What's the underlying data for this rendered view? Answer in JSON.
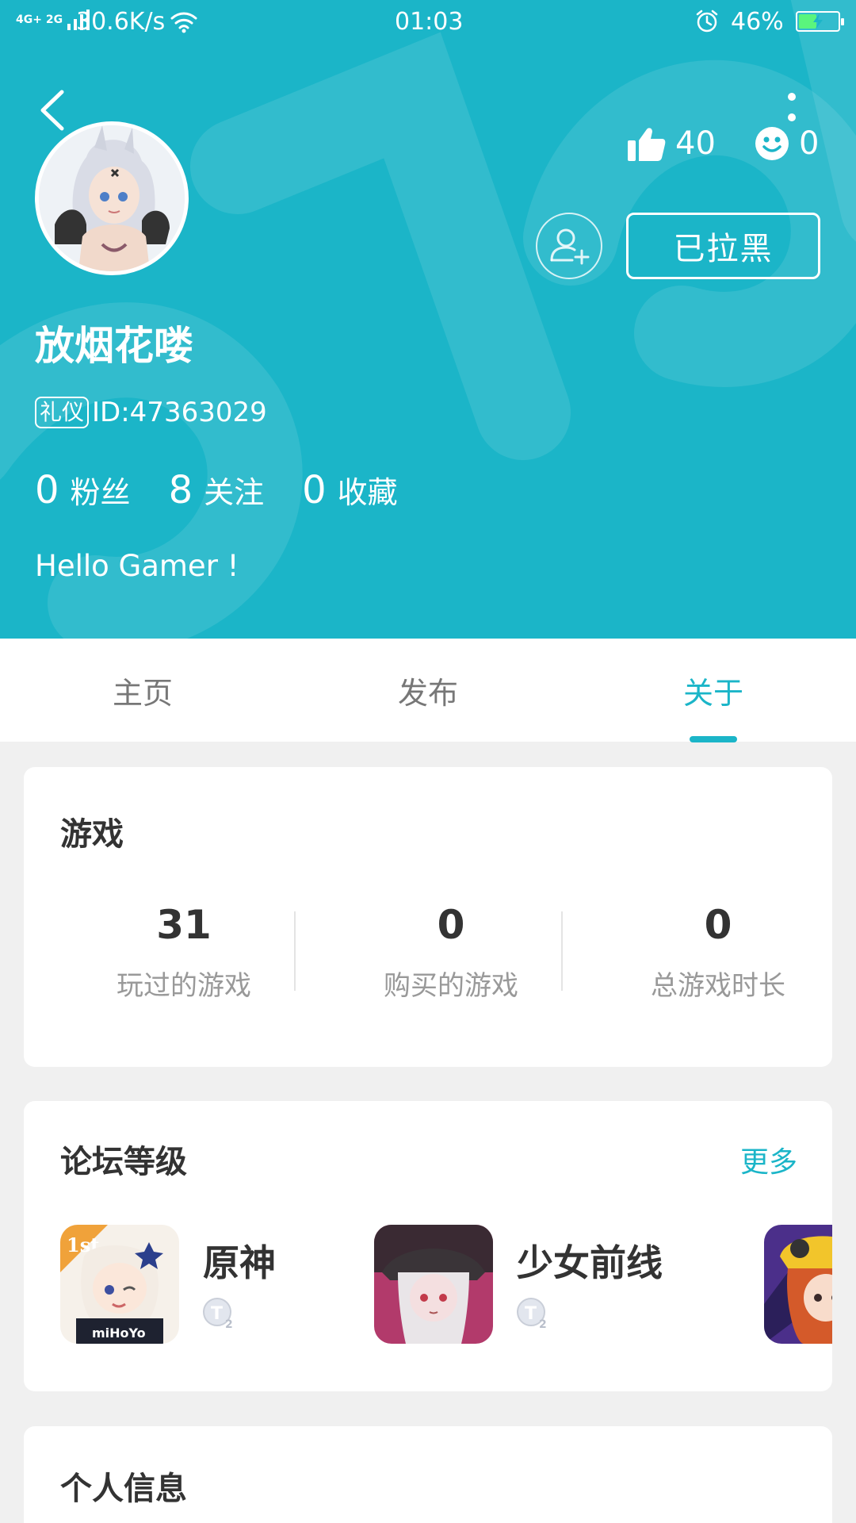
{
  "status_bar": {
    "network": "4G+ 2G",
    "speed": "30.6K/s",
    "time": "01:03",
    "battery": "46%",
    "battery_level": 0.46,
    "icons": [
      "signal-icon",
      "wifi-icon",
      "alarm-icon",
      "battery-icon"
    ]
  },
  "colors": {
    "primary": "#1bb5c8",
    "background": "#f0f0f0",
    "card": "#ffffff"
  },
  "header": {
    "back_icon": "chevron-left-icon",
    "more_icon": "more-vertical-icon",
    "likes": "40",
    "smiles": "0",
    "follow_icon": "add-user-icon",
    "block_button": "已拉黑",
    "username": "放烟花喽",
    "tag": "礼仪",
    "id": "ID:47363029",
    "stats": [
      {
        "value": "0",
        "label": "粉丝"
      },
      {
        "value": "8",
        "label": "关注"
      },
      {
        "value": "0",
        "label": "收藏"
      }
    ],
    "bio": "Hello Gamer !"
  },
  "tabs": [
    {
      "label": "主页",
      "active": false
    },
    {
      "label": "发布",
      "active": false
    },
    {
      "label": "关于",
      "active": true
    }
  ],
  "games": {
    "title": "游戏",
    "stats": [
      {
        "value": "31",
        "label": "玩过的游戏"
      },
      {
        "value": "0",
        "label": "购买的游戏"
      },
      {
        "value": "0",
        "label": "总游戏时长"
      }
    ]
  },
  "forum": {
    "title": "论坛等级",
    "more": "更多",
    "items": [
      {
        "name": "原神",
        "level_icon": "t2-level-icon"
      },
      {
        "name": "少女前线",
        "level_icon": "t2-level-icon"
      },
      {
        "name": "",
        "level_icon": ""
      }
    ]
  },
  "info": {
    "title": "个人信息"
  }
}
